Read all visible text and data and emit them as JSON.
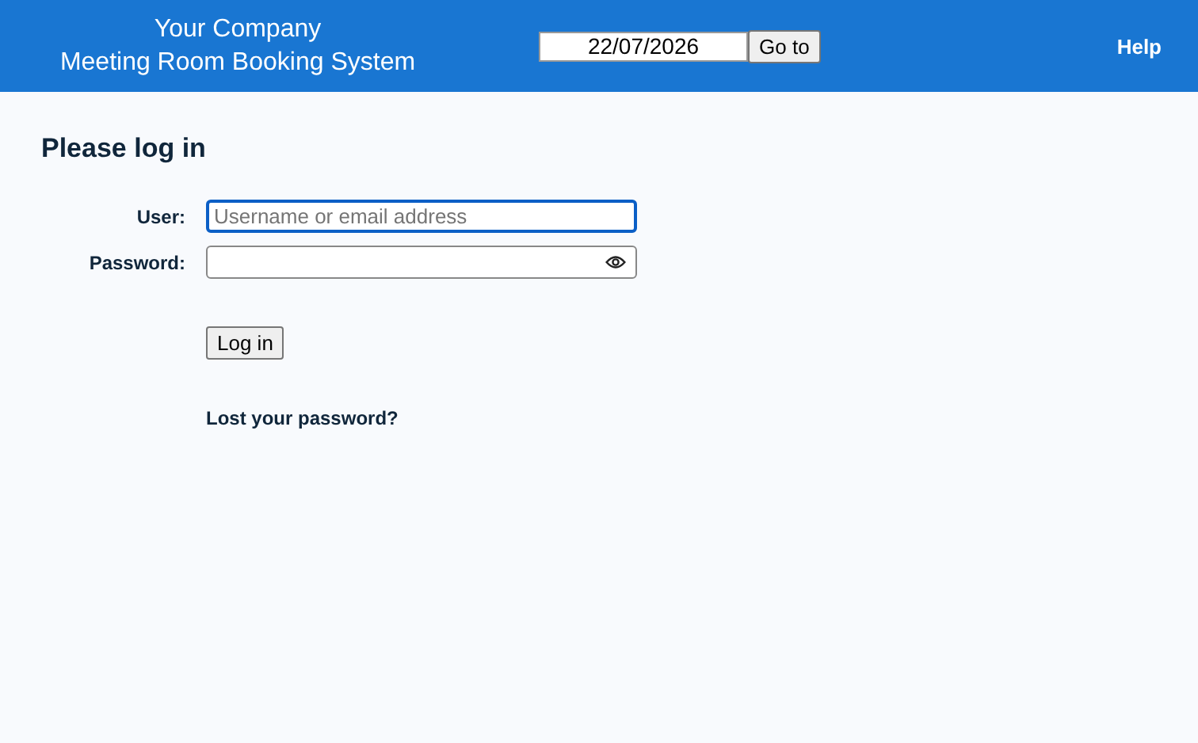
{
  "header": {
    "company": "Your Company",
    "system": "Meeting Room Booking System",
    "date": {
      "value": "22/07/2026"
    },
    "goto_button": "Go to",
    "help_link": "Help"
  },
  "login": {
    "title": "Please log in",
    "fields": [
      {
        "label": "User:",
        "placeholder": "Username or email address",
        "focused": true,
        "kind": "text"
      },
      {
        "label": "Password:",
        "focused": false,
        "kind": "password"
      }
    ],
    "submit_button": "Log in",
    "lost_password_link": "Lost your password?"
  }
}
